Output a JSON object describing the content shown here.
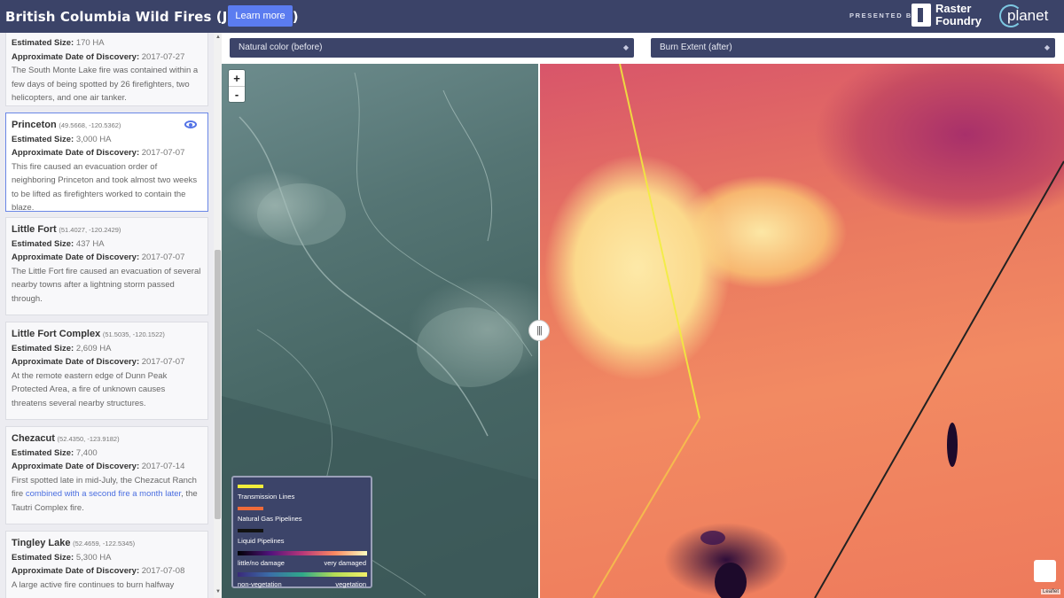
{
  "header": {
    "title": "British Columbia Wild Fires (July 2017)",
    "learn_more": "Learn more",
    "presented_by": "PRESENTED BY",
    "sponsor1_line1": "Raster",
    "sponsor1_line2": "Foundry",
    "sponsor2": "planet"
  },
  "sidebar": {
    "cards": [
      {
        "title": "",
        "coords": "",
        "size_label": "Estimated Size:",
        "size": "170 HA",
        "date_label": "Approximate Date of Discovery:",
        "date": "2017-07-27",
        "desc": "The South Monte Lake fire was contained within a few days of being spotted by 26 firefighters, two helicopters, and one air tanker."
      },
      {
        "title": "Princeton",
        "coords": "(49.5668, -120.5362)",
        "size_label": "Estimated Size:",
        "size": "3,000 HA",
        "date_label": "Approximate Date of Discovery:",
        "date": "2017-07-07",
        "desc": "This fire caused an evacuation order of neighboring Princeton and took almost two weeks to be lifted as firefighters worked to contain the blaze."
      },
      {
        "title": "Little Fort",
        "coords": "(51.4027, -120.2429)",
        "size_label": "Estimated Size:",
        "size": "437 HA",
        "date_label": "Approximate Date of Discovery:",
        "date": "2017-07-07",
        "desc": "The Little Fort fire caused an evacuation of several nearby towns after a lightning storm passed through."
      },
      {
        "title": "Little Fort Complex",
        "coords": "(51.5035, -120.1522)",
        "size_label": "Estimated Size:",
        "size": "2,609 HA",
        "date_label": "Approximate Date of Discovery:",
        "date": "2017-07-07",
        "desc": "At the remote eastern edge of Dunn Peak Protected Area, a fire of unknown causes threatens several nearby structures."
      },
      {
        "title": "Chezacut",
        "coords": "(52.4350, -123.9182)",
        "size_label": "Estimated Size:",
        "size": "7,400",
        "date_label": "Approximate Date of Discovery:",
        "date": "2017-07-14",
        "desc_pre": "First spotted late in mid-July, the Chezacut Ranch fire ",
        "desc_link": "combined with a second fire a month later",
        "desc_post": ", the Tautri Complex fire."
      },
      {
        "title": "Tingley Lake",
        "coords": "(52.4659, -122.5345)",
        "size_label": "Estimated Size:",
        "size": "5,300 HA",
        "date_label": "Approximate Date of Discovery:",
        "date": "2017-07-08",
        "desc": "A large active fire continues to burn halfway"
      }
    ]
  },
  "map": {
    "left_select": "Natural color (before)",
    "right_select": "Burn Extent (after)",
    "zoom_in": "+",
    "zoom_out": "-",
    "handle": "|||",
    "attribution": "Leaflet",
    "legend": {
      "transmission": "Transmission Lines",
      "gas": "Natural Gas Pipelines",
      "liquid": "Liquid Pipelines",
      "damage_low": "little/no damage",
      "damage_high": "very damaged",
      "veg_low": "non-vegetation",
      "veg_high": "vegetation"
    },
    "colors": {
      "transmission": "#f2ee3b",
      "gas": "#ef6b3a",
      "liquid": "#111111"
    }
  }
}
